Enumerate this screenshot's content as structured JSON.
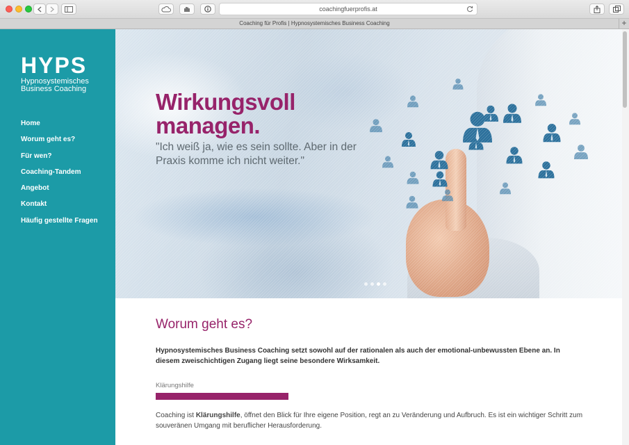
{
  "browser": {
    "url": "coachingfuerprofis.at",
    "tab_title": "Coaching für Profis | Hypnosystemisches Business Coaching",
    "new_tab_label": "+"
  },
  "sidebar": {
    "logo": "HYPS",
    "tagline_line1": "Hypnosystemisches",
    "tagline_line2": "Business Coaching",
    "nav": [
      "Home",
      "Worum geht es?",
      "Für wen?",
      "Coaching-Tandem",
      "Angebot",
      "Kontakt",
      "Häufig gestellte Fragen"
    ]
  },
  "hero": {
    "headline_line1": "Wirkungsvoll",
    "headline_line2": "managen.",
    "quote": "\"Ich weiß ja, wie es sein sollte. Aber in der Praxis komme ich nicht weiter.\""
  },
  "content": {
    "title": "Worum geht es?",
    "lead": "Hypnosystemisches Business Coaching setzt sowohl auf der rationalen als auch der emotional-unbewussten Ebene an. In diesem zweischichtigen Zugang liegt seine besondere Wirksamkeit.",
    "bar_label": "Klärungshilfe",
    "body_prefix": "Coaching ist ",
    "body_bold": "Klärungshilfe",
    "body_suffix": ", öffnet den Blick für Ihre eigene Position, regt an zu Veränderung und Aufbruch. Es ist ein wichtiger Schritt zum souveränen Umgang mit beruflicher Herausforderung."
  },
  "colors": {
    "sidebar": "#1c9ba7",
    "accent": "#97236a"
  }
}
